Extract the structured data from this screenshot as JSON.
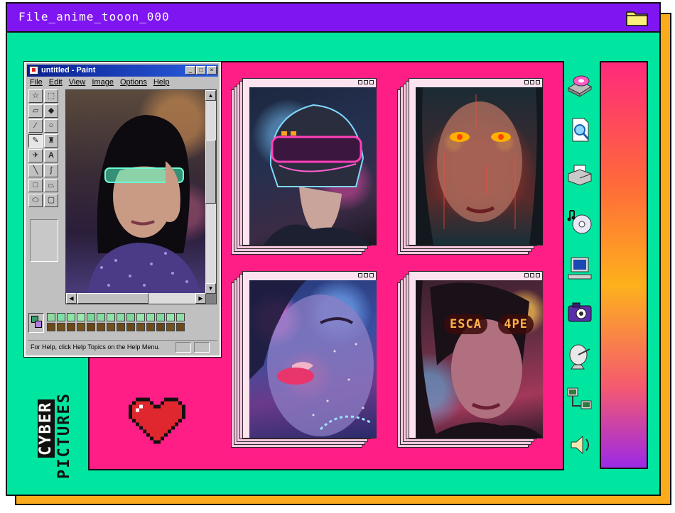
{
  "window": {
    "title": "File_anime_tooon_000",
    "folder_icon": "folder-icon"
  },
  "paint": {
    "title": "untitled - Paint",
    "menu": [
      "File",
      "Edit",
      "View",
      "Image",
      "Options",
      "Help"
    ],
    "window_buttons": [
      "_",
      "□",
      "×"
    ],
    "status": "For Help, click Help Topics on the Help Menu."
  },
  "gallery": {
    "photos": [
      "helmet-visor-portrait",
      "glowing-eyes-portrait",
      "neon-lips-portrait",
      "escape-glasses-portrait"
    ],
    "glasses_text": [
      "ESCA",
      "4PE"
    ]
  },
  "sidebar_icons": [
    "cd-drive-icon",
    "document-search-icon",
    "printer-icon",
    "music-cd-icon",
    "computer-icon",
    "camera-icon",
    "satellite-dish-icon",
    "network-icon",
    "speaker-icon"
  ],
  "branding": {
    "line1": "CYBER",
    "line2": "PICTURES"
  },
  "colors": {
    "background": "#00e6a0",
    "titlebar": "#7f16f2",
    "pink_area": "#ff1e86",
    "shadow": "#f9ab1c"
  }
}
